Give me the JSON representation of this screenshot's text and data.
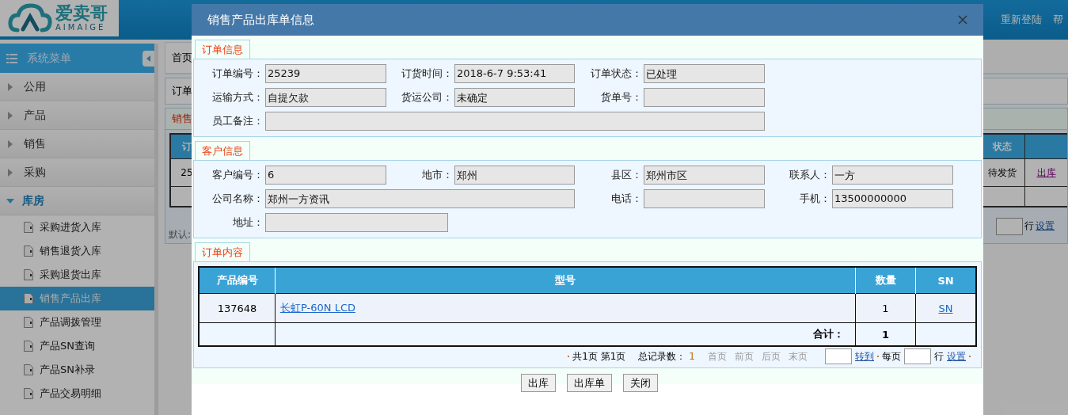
{
  "header": {
    "logo_text": "爱卖哥",
    "logo_subtext": "AIMAIGE",
    "links": [
      "重新登陆",
      "帮"
    ]
  },
  "sidebar": {
    "title": "系统菜单",
    "items": [
      {
        "label": "公用",
        "expanded": false
      },
      {
        "label": "产品",
        "expanded": false
      },
      {
        "label": "销售",
        "expanded": false
      },
      {
        "label": "采购",
        "expanded": false
      },
      {
        "label": "库房",
        "expanded": true,
        "children": [
          {
            "label": "采购进货入库",
            "selected": false
          },
          {
            "label": "销售退货入库",
            "selected": false
          },
          {
            "label": "采购退货出库",
            "selected": false
          },
          {
            "label": "销售产品出库",
            "selected": true
          },
          {
            "label": "产品调拨管理",
            "selected": false
          },
          {
            "label": "产品SN查询",
            "selected": false
          },
          {
            "label": "产品SN补录",
            "selected": false
          },
          {
            "label": "产品交易明细",
            "selected": false
          }
        ]
      }
    ]
  },
  "background_page": {
    "tab": "首页",
    "filter_label": "订单",
    "panel_title": "销售",
    "columns": [
      "订",
      "状态"
    ],
    "row": {
      "order": "25",
      "status": "待发货",
      "action": "出库"
    },
    "note": "默认:",
    "pager": {
      "rows_label": "行",
      "settings_link": "设置"
    }
  },
  "dialog": {
    "title": "销售产品出库单信息",
    "sections": [
      {
        "title": "订单信息",
        "rows": [
          [
            {
              "label": "订单编号：",
              "value": "25239",
              "kind": "normal"
            },
            {
              "label": "订货时间：",
              "value": "2018-6-7 9:53:41",
              "kind": "normal"
            },
            {
              "label": "订单状态：",
              "value": "已处理",
              "kind": "normal"
            }
          ],
          [
            {
              "label": "运输方式：",
              "value": "自提欠款",
              "kind": "normal"
            },
            {
              "label": "货运公司：",
              "value": "未确定",
              "kind": "normal"
            },
            {
              "label": "货单号：",
              "kind": "normal"
            }
          ],
          [
            {
              "label": "员工备注：",
              "kind": "normal"
            },
            {
              "kind": "span"
            },
            {
              "kind": "span"
            }
          ]
        ]
      },
      {
        "title": "客户信息",
        "rows": [
          [
            {
              "label": "客户编号：",
              "value": "6",
              "kind": "normal"
            },
            {
              "label": "地市：",
              "value": "郑州",
              "kind": "normal"
            },
            {
              "label": "县区：",
              "value": "郑州市区",
              "kind": "normal"
            },
            {
              "label": "联系人：",
              "value": "一方",
              "kind": "normal"
            }
          ],
          [
            {
              "label": "公司名称：",
              "value": "郑州一方资讯",
              "kind": "normal"
            },
            {
              "kind": "span"
            },
            {
              "label": "电话：",
              "kind": "normal"
            },
            {
              "label": "手机：",
              "value": "13500000000",
              "kind": "normal"
            }
          ],
          [
            {
              "label": "地址：",
              "kind": "address"
            },
            {
              "kind": "span"
            }
          ]
        ]
      }
    ],
    "order_content": {
      "title": "订单内容",
      "columns": [
        "产品编号",
        "型号",
        "数量",
        "SN"
      ],
      "rows": [
        {
          "product_no": "137648",
          "model": "长虹P-60N LCD",
          "quantity": "1",
          "sn": "SN"
        }
      ],
      "total_label": "合计：",
      "total_quantity": "1",
      "pager": {
        "pages": "共1页 第1页",
        "records_label": "总记录数：",
        "records": "1",
        "nav": [
          {
            "label": "首页",
            "disabled": true
          },
          {
            "label": "前页",
            "disabled": true
          },
          {
            "label": "后页",
            "disabled": true
          },
          {
            "label": "末页",
            "disabled": true
          }
        ],
        "goto_link": "转到",
        "per_page_label": "每页",
        "rows_label": "行",
        "settings_link": "设置"
      }
    },
    "buttons": [
      "出库",
      "出库单",
      "关闭"
    ]
  }
}
